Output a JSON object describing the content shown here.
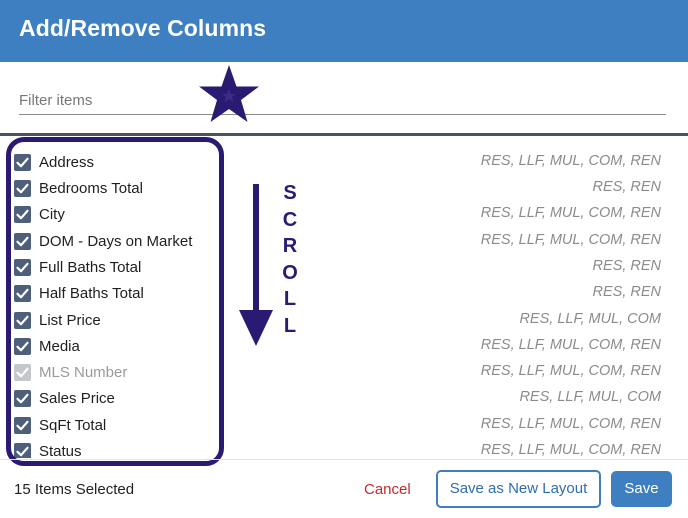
{
  "dialog": {
    "title": "Add/Remove Columns"
  },
  "filter": {
    "placeholder": "Filter items",
    "value": ""
  },
  "annotations": {
    "scroll_text": [
      "S",
      "C",
      "R",
      "O",
      "L",
      "L"
    ],
    "star_color": "#2a1a72",
    "arrow_color": "#2a1a72",
    "box_color": "#2a1a72"
  },
  "columns": [
    {
      "label": "Address",
      "types": "RES, LLF, MUL, COM, REN",
      "checked": true,
      "disabled": false
    },
    {
      "label": "Bedrooms Total",
      "types": "RES, REN",
      "checked": true,
      "disabled": false
    },
    {
      "label": "City",
      "types": "RES, LLF, MUL, COM, REN",
      "checked": true,
      "disabled": false
    },
    {
      "label": "DOM - Days on Market",
      "types": "RES, LLF, MUL, COM, REN",
      "checked": true,
      "disabled": false
    },
    {
      "label": "Full Baths Total",
      "types": "RES, REN",
      "checked": true,
      "disabled": false
    },
    {
      "label": "Half Baths Total",
      "types": "RES, REN",
      "checked": true,
      "disabled": false
    },
    {
      "label": "List Price",
      "types": "RES, LLF, MUL, COM",
      "checked": true,
      "disabled": false
    },
    {
      "label": "Media",
      "types": "RES, LLF, MUL, COM, REN",
      "checked": true,
      "disabled": false
    },
    {
      "label": "MLS Number",
      "types": "RES, LLF, MUL, COM, REN",
      "checked": true,
      "disabled": true
    },
    {
      "label": "Sales Price",
      "types": "RES, LLF, MUL, COM",
      "checked": true,
      "disabled": false
    },
    {
      "label": "SqFt Total",
      "types": "RES, LLF, MUL, COM, REN",
      "checked": true,
      "disabled": false
    },
    {
      "label": "Status",
      "types": "RES, LLF, MUL, COM, REN",
      "checked": true,
      "disabled": false
    }
  ],
  "footer": {
    "selected_count": "15 Items Selected",
    "cancel_label": "Cancel",
    "save_layout_label": "Save as New Layout",
    "save_label": "Save"
  },
  "colors": {
    "header": "#3d7fc1",
    "checkbox": "#4d5f7a",
    "cancel": "#c52a2a"
  }
}
